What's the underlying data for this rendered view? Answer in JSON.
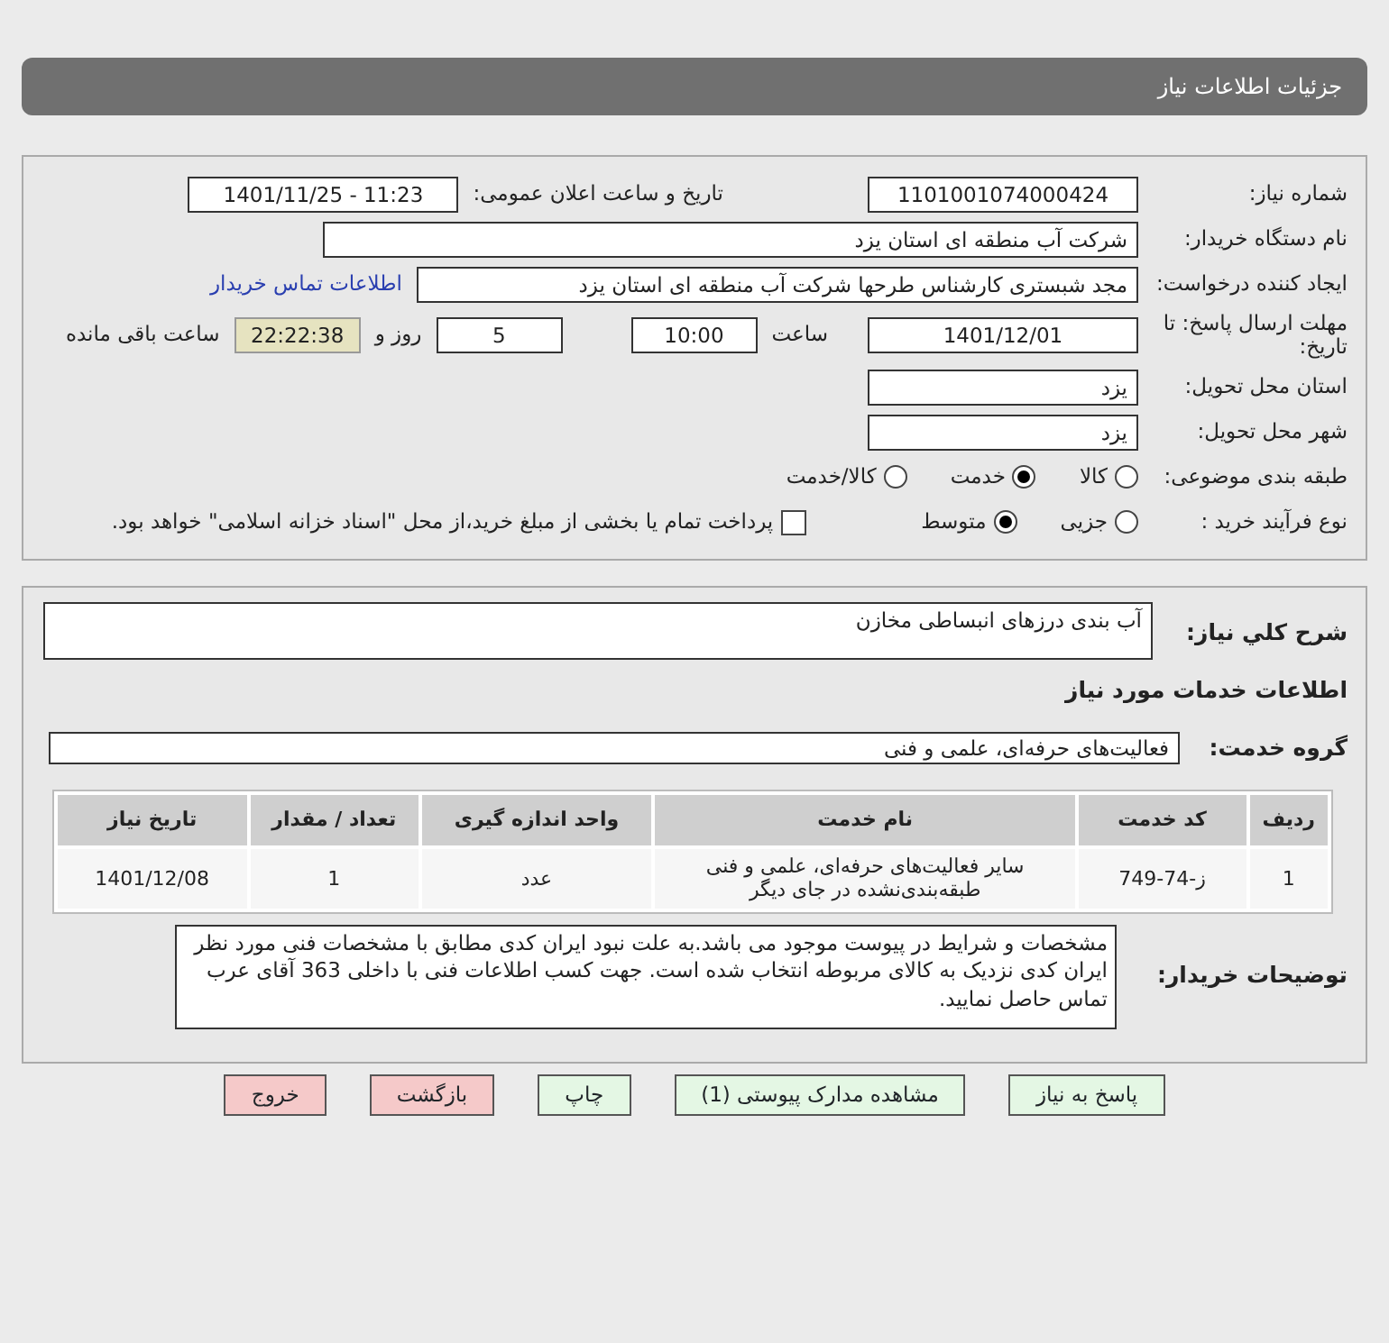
{
  "page_title": "جزئیات اطلاعات نیاز",
  "details": {
    "need_number": {
      "label": "شماره نیاز:",
      "value": "1101001074000424"
    },
    "announce": {
      "label": "تاریخ و ساعت اعلان عمومی:",
      "value": "1401/11/25 - 11:23"
    },
    "buyer_org": {
      "label": "نام دستگاه خریدار:",
      "value": "شرکت آب منطقه ای استان یزد"
    },
    "requester": {
      "label": "ایجاد کننده درخواست:",
      "value": "مجد شبستری کارشناس طرحها شرکت آب منطقه ای استان یزد"
    },
    "contact_link": "اطلاعات تماس خریدار",
    "deadline": {
      "label": "مهلت ارسال پاسخ: تا تاریخ:",
      "date": "1401/12/01",
      "time_label": "ساعت",
      "time": "10:00",
      "days": "5",
      "days_label": "روز و",
      "remaining": "22:22:38",
      "remaining_label": "ساعت باقی مانده"
    },
    "province": {
      "label": "استان محل تحویل:",
      "value": "یزد"
    },
    "city": {
      "label": "شهر محل تحویل:",
      "value": "یزد"
    },
    "category": {
      "label": "طبقه بندی موضوعی:",
      "options": [
        {
          "label": "کالا",
          "selected": false
        },
        {
          "label": "خدمت",
          "selected": true
        },
        {
          "label": "کالا/خدمت",
          "selected": false
        }
      ]
    },
    "process": {
      "label": "نوع فرآیند خرید :",
      "options": [
        {
          "label": "جزیی",
          "selected": false
        },
        {
          "label": "متوسط",
          "selected": true
        }
      ],
      "payment": {
        "label": "پرداخت تمام یا بخشی از مبلغ خرید،از محل \"اسناد خزانه اسلامی\" خواهد بود.",
        "checked": false
      }
    }
  },
  "summary": {
    "label": "شرح کلي نياز:",
    "value": "آب بندی درزهای انبساطی مخازن"
  },
  "services_heading": "اطلاعات خدمات مورد نیاز",
  "service_group": {
    "label": "گروه خدمت:",
    "value": "فعالیت‌های حرفه‌ای، علمی و فنی"
  },
  "table": {
    "columns": [
      "ردیف",
      "کد خدمت",
      "نام خدمت",
      "واحد اندازه گیری",
      "تعداد / مقدار",
      "تاریخ نیاز"
    ],
    "rows": [
      [
        "1",
        "ز-74-749",
        "سایر فعالیت‌های حرفه‌ای، علمی و فنی طبقه‌بندی‌نشده در جای دیگر",
        "عدد",
        "1",
        "1401/12/08"
      ]
    ]
  },
  "buyer_notes": {
    "label": "توضیحات خریدار:",
    "value": "مشخصات و شرایط در پیوست موجود می باشد.به علت نبود ایران کدی مطابق با مشخصات فنی مورد نظر ایران کدی نزدیک به کالای مربوطه انتخاب شده است. جهت کسب اطلاعات فنی با داخلی 363 آقای عرب تماس حاصل نمایید."
  },
  "buttons": [
    {
      "label": "پاسخ به نیاز",
      "kind": "action"
    },
    {
      "label": "مشاهده مدارک پیوستی (1)",
      "kind": "action"
    },
    {
      "label": "چاپ",
      "kind": "action"
    },
    {
      "label": "بازگشت",
      "kind": "back"
    },
    {
      "label": "خروج",
      "kind": "exit"
    }
  ]
}
